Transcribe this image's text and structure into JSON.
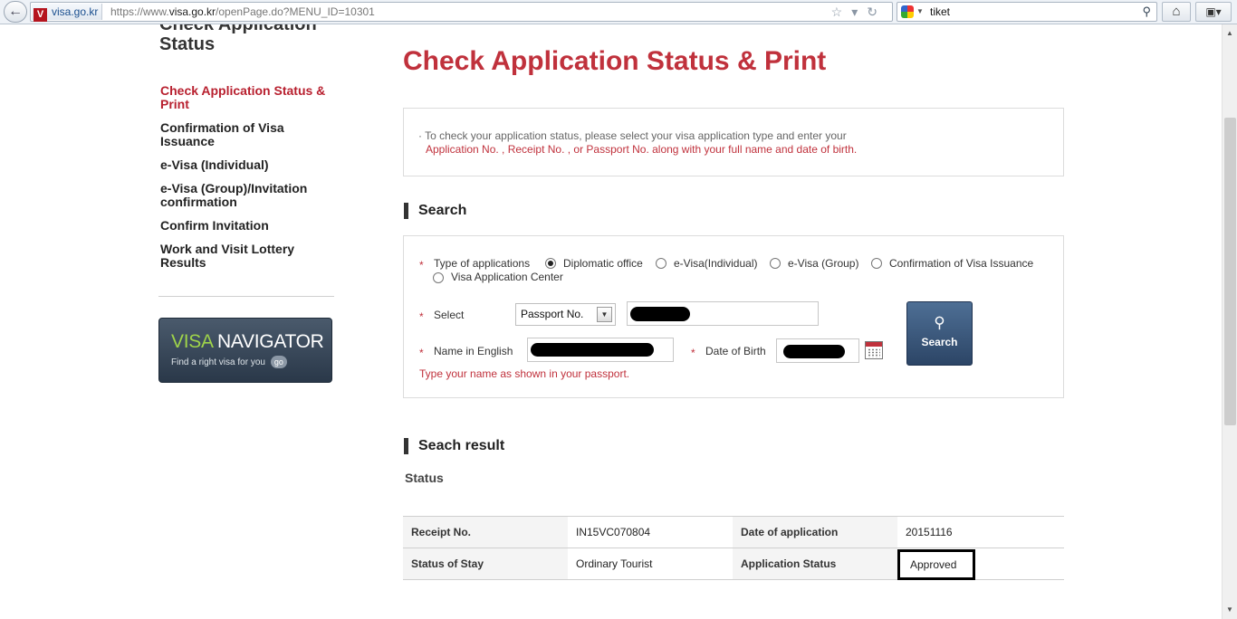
{
  "browser": {
    "site_name": "visa.go.kr",
    "site_favicon": "V",
    "url_prefix": "https://www.",
    "url_domain": "visa.go.kr",
    "url_path": "/openPage.do?MENU_ID=10301",
    "search_query": "tiket"
  },
  "sidebar": {
    "title": "Check Application Status",
    "items": [
      {
        "label": "Check Application Status & Print",
        "active": true
      },
      {
        "label": "Confirmation of Visa Issuance",
        "active": false
      },
      {
        "label": "e-Visa (Individual)",
        "active": false
      },
      {
        "label": "e-Visa (Group)/Invitation confirmation",
        "active": false
      },
      {
        "label": "Confirm Invitation",
        "active": false
      },
      {
        "label": "Work and Visit Lottery Results",
        "active": false
      }
    ],
    "banner": {
      "title_part1": "VISA",
      "title_part2": " NAVIGATOR",
      "subtitle": "Find a right visa for you",
      "go_label": "go"
    }
  },
  "main": {
    "title": "Check Application Status & Print",
    "info_line1": "· To check your application status, please select your visa application type and enter your",
    "info_line2": "Application No. , Receipt No. , or Passport No. along with your full name and date of birth.",
    "search_section": "Search",
    "form": {
      "type_label": "Type of applications",
      "types": [
        {
          "label": "Diplomatic office",
          "checked": true
        },
        {
          "label": "e-Visa(Individual)",
          "checked": false
        },
        {
          "label": "e-Visa (Group)",
          "checked": false
        },
        {
          "label": "Confirmation of Visa Issuance",
          "checked": false
        },
        {
          "label": "Visa Application Center",
          "checked": false
        }
      ],
      "select_label": "Select",
      "select_value": "Passport No.",
      "name_label": "Name in English",
      "dob_label": "Date of Birth",
      "hint": "Type your name as shown in your passport.",
      "search_button": "Search"
    },
    "result_section": "Seach result",
    "status_heading": "Status",
    "result": {
      "rows": [
        [
          {
            "label": "Receipt No.",
            "value": "IN15VC070804"
          },
          {
            "label": "Date of application",
            "value": "20151116"
          }
        ],
        [
          {
            "label": "Status of Stay",
            "value": "Ordinary Tourist"
          },
          {
            "label": "Application Status",
            "value": "Approved"
          }
        ]
      ]
    }
  },
  "colors": {
    "accent": "#c0313c",
    "banner": "#2a3849",
    "banner_highlight": "#9fd44a"
  }
}
